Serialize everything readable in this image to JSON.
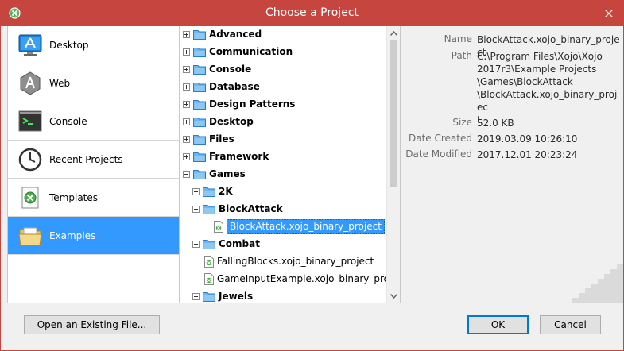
{
  "window": {
    "title": "Choose a Project",
    "accent_color": "#c6453f",
    "selection_color": "#3399ff"
  },
  "categories": [
    {
      "label": "Desktop",
      "icon": "app-store-icon"
    },
    {
      "label": "Web",
      "icon": "web-app-icon"
    },
    {
      "label": "Console",
      "icon": "terminal-icon"
    },
    {
      "label": "Recent Projects",
      "icon": "clock-icon"
    },
    {
      "label": "Templates",
      "icon": "templates-icon"
    },
    {
      "label": "Examples",
      "icon": "folder-open-icon",
      "selected": true
    }
  ],
  "tree": [
    {
      "label": "Advanced",
      "type": "folder",
      "expander": "plus"
    },
    {
      "label": "Communication",
      "type": "folder",
      "expander": "plus"
    },
    {
      "label": "Console",
      "type": "folder",
      "expander": "plus"
    },
    {
      "label": "Database",
      "type": "folder",
      "expander": "plus"
    },
    {
      "label": "Design Patterns",
      "type": "folder",
      "expander": "plus"
    },
    {
      "label": "Desktop",
      "type": "folder",
      "expander": "plus"
    },
    {
      "label": "Files",
      "type": "folder",
      "expander": "plus"
    },
    {
      "label": "Framework",
      "type": "folder",
      "expander": "plus"
    },
    {
      "label": "Games",
      "type": "folder",
      "expander": "minus"
    },
    {
      "label": "2K",
      "type": "folder",
      "expander": "plus"
    },
    {
      "label": "BlockAttack",
      "type": "folder",
      "expander": "minus"
    },
    {
      "label": "BlockAttack.xojo_binary_project",
      "type": "file",
      "selected": true
    },
    {
      "label": "Combat",
      "type": "folder",
      "expander": "plus"
    },
    {
      "label": "FallingBlocks.xojo_binary_project",
      "type": "file"
    },
    {
      "label": "GameInputExample.xojo_binary_proje...",
      "type": "file"
    },
    {
      "label": "Jewels",
      "type": "folder",
      "expander": "plus"
    }
  ],
  "details": {
    "name_label": "Name",
    "name_value": "BlockAttack.xojo_binary_project",
    "path_label": "Path",
    "path_value": "C:\\Program Files\\Xojo\\Xojo\n2017r3\\Example Projects\n\\Games\\BlockAttack\n\\BlockAttack.xojo_binary_projec\nt",
    "size_label": "Size",
    "size_value": "52.0 KB",
    "created_label": "Date Created",
    "created_value": "2019.03.09 10:26:10",
    "modified_label": "Date Modified",
    "modified_value": "2017.12.01 20:23:24"
  },
  "buttons": {
    "open_existing": "Open an Existing File...",
    "ok": "OK",
    "cancel": "Cancel"
  }
}
